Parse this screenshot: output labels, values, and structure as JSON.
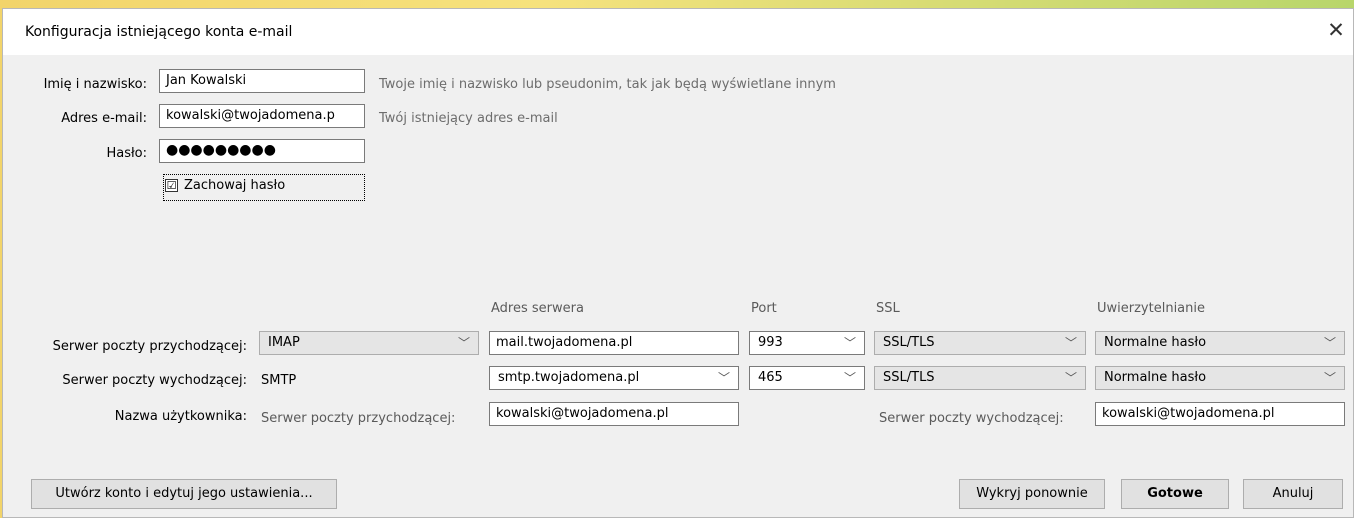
{
  "dialog": {
    "title": "Konfiguracja istniejącego konta e-mail"
  },
  "identity": {
    "name_label": "Imię i nazwisko:",
    "name_value": "Jan Kowalski",
    "name_hint": "Twoje imię i nazwisko lub pseudonim, tak jak będą wyświetlane innym",
    "email_label": "Adres e-mail:",
    "email_value": "kowalski@twojadomena.p",
    "email_hint": "Twój istniejący adres e-mail",
    "password_label": "Hasło:",
    "password_value": "●●●●●●●●●",
    "remember_label": "Zachowaj hasło",
    "remember_checked": "☑"
  },
  "columns": {
    "server_address": "Adres serwera",
    "port": "Port",
    "ssl": "SSL",
    "auth": "Uwierzytelnianie"
  },
  "incoming": {
    "label": "Serwer poczty przychodzącej:",
    "protocol": "IMAP",
    "server": "mail.twojadomena.pl",
    "port": "993",
    "ssl": "SSL/TLS",
    "auth": "Normalne hasło"
  },
  "outgoing": {
    "label": "Serwer poczty wychodzącej:",
    "protocol": "SMTP",
    "server": "smtp.twojadomena.pl",
    "port": "465",
    "ssl": "SSL/TLS",
    "auth": "Normalne hasło"
  },
  "username": {
    "label": "Nazwa użytkownika:",
    "incoming_label": "Serwer poczty przychodzącej:",
    "incoming_value": "kowalski@twojadomena.pl",
    "outgoing_label": "Serwer poczty wychodzącej:",
    "outgoing_value": "kowalski@twojadomena.pl"
  },
  "buttons": {
    "create_edit": "Utwórz konto i edytuj jego ustawienia...",
    "retest": "Wykryj ponownie",
    "done": "Gotowe",
    "cancel": "Anuluj"
  },
  "icons": {
    "close": "✕",
    "chevron": "﹀"
  }
}
